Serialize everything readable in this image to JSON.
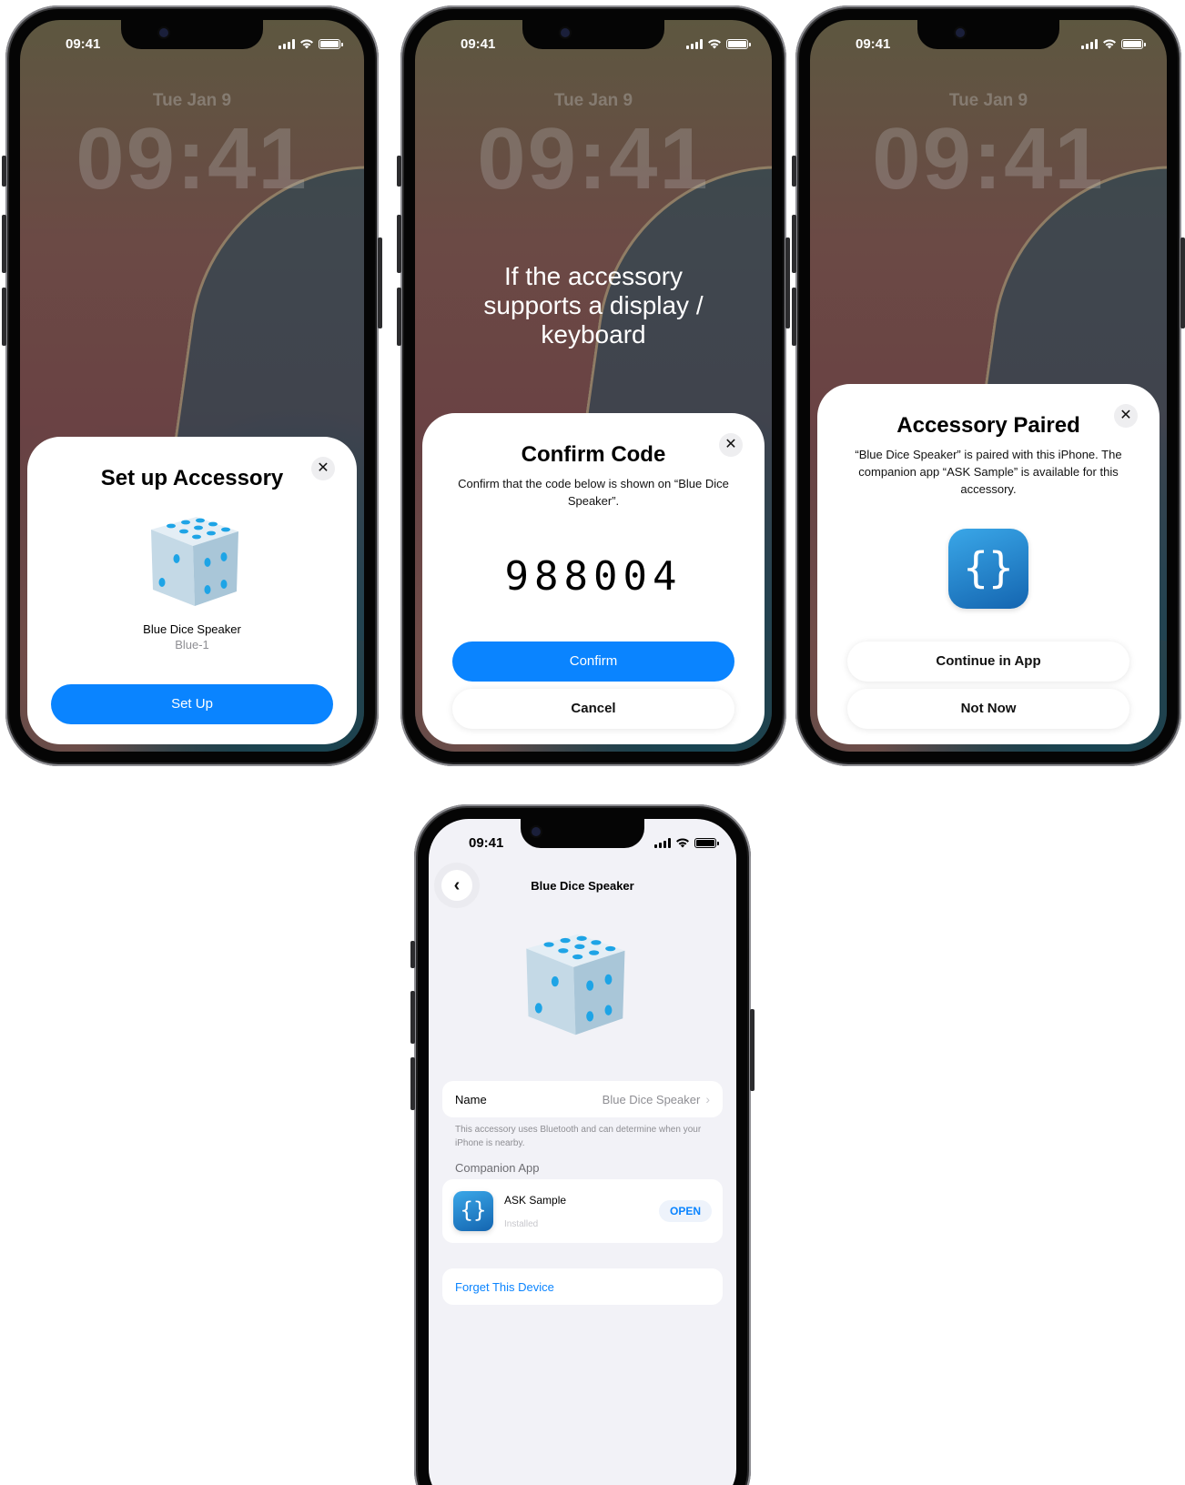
{
  "status_time": "09:41",
  "lockscreen": {
    "date": "Tue Jan 9",
    "time": "09:41"
  },
  "setup": {
    "title": "Set up Accessory",
    "close": "✕",
    "device_name": "Blue Dice Speaker",
    "device_model": "Blue-1",
    "setup_button": "Set Up"
  },
  "confirm": {
    "note": "If the accessory supports a display / keyboard",
    "title": "Confirm Code",
    "close": "✕",
    "description": "Confirm that the code below is shown on “Blue Dice Speaker”.",
    "code": "988004",
    "confirm_button": "Confirm",
    "cancel_button": "Cancel"
  },
  "paired": {
    "title": "Accessory Paired",
    "close": "✕",
    "description": "“Blue Dice Speaker” is paired with this iPhone. The companion app “ASK Sample” is available for this accessory.",
    "app_icon_glyph": "{}",
    "continue_button": "Continue in App",
    "not_now_button": "Not Now"
  },
  "settings": {
    "back": "‹",
    "title": "Blue Dice Speaker",
    "name_label": "Name",
    "name_value": "Blue Dice Speaker",
    "chevron": "›",
    "footnote": "This accessory uses Bluetooth and can determine when your iPhone is nearby.",
    "companion_header": "Companion App",
    "app_name": "ASK Sample",
    "app_status": "Installed",
    "app_icon_glyph": "{}",
    "open_button": "OPEN",
    "forget": "Forget This Device"
  },
  "colors": {
    "accent": "#0a84ff",
    "settings_bg": "#f2f2f7",
    "sheet": "#ffffff"
  },
  "icons": [
    "close-icon",
    "back-chevron-icon",
    "chevron-right-icon",
    "signal-icon",
    "wifi-icon",
    "battery-icon",
    "dice-image",
    "app-icon"
  ]
}
